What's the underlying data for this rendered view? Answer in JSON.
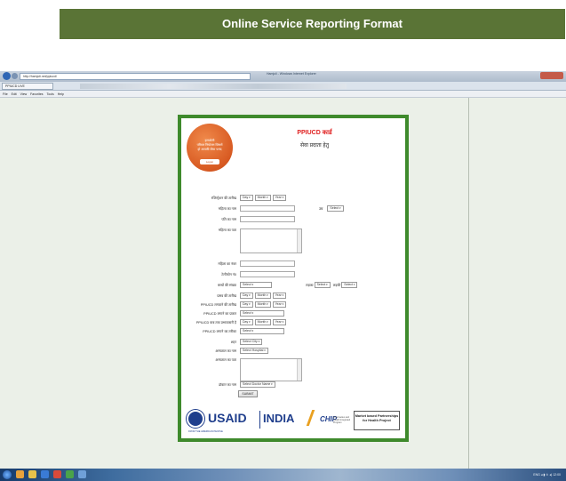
{
  "slide": {
    "title": "Online Service Reporting Format"
  },
  "browser": {
    "address": "http://hamjoli.net/ppiucd/",
    "window_title": "Hamjoli - Windows Internet Explorer",
    "tab_label": "PPIUCD LIVE",
    "menu": [
      "File",
      "Edit",
      "View",
      "Favorites",
      "Tools",
      "Help"
    ]
  },
  "form": {
    "heading": "PPIUCD कार्ड",
    "subheading": "सेवा प्रदाता हेतु",
    "badge_text": "हमजोली\nपरिवार नियोजन जिसमें\nहो आपकी जैसा पसंद",
    "badge_pill": "Logon",
    "fields": {
      "registration_date": {
        "label": "रजिस्ट्रेशन की तारीख",
        "day": "Day",
        "month": "Month",
        "year": "Year"
      },
      "woman_name": {
        "label": "महिला का नाम"
      },
      "age": {
        "label": "उम्र",
        "value": "Select"
      },
      "husband_name": {
        "label": "पति का नाम"
      },
      "woman_address": {
        "label": "महिला का पता"
      },
      "woman_mobile": {
        "label": "महिला का नंबर"
      },
      "telephone": {
        "label": "टेलीफोन नं0"
      },
      "children_count": {
        "label": "बच्चों की संख्या",
        "value": "Select",
        "boys_label": "लड़का",
        "boys_value": "Select",
        "girls_label": "लड़की",
        "girls_value": "Select"
      },
      "delivery_date": {
        "label": "प्रसव की तारीख",
        "day": "Day",
        "month": "Month",
        "year": "Year"
      },
      "ppiucd_date": {
        "label": "PPIUCD लगवाने की तारीख",
        "day": "Day",
        "month": "Month",
        "year": "Year"
      },
      "ppiucd_type": {
        "label": "PPIUCD लगाने का प्रकार",
        "value": "Select"
      },
      "ppiucd_removal_date": {
        "label": "PPIUCD कब तक प्रभावकारी है",
        "day": "Day",
        "month": "Month",
        "year": "Year"
      },
      "ppiucd_provider": {
        "label": "PPIUCD लगाने का तरीका",
        "value": "Select"
      },
      "city": {
        "label": "शहर",
        "value": "Select City"
      },
      "hospital": {
        "label": "अस्पताल का नाम",
        "value": "Select Hospital"
      },
      "hospital_address": {
        "label": "अस्पताल का पता"
      },
      "doctor_name": {
        "label": "डॉक्टर का नाम",
        "value": "Select Doctor Name"
      }
    },
    "submit_label": "SUBMIT"
  },
  "footer": {
    "usaid": "USAID",
    "usaid_tagline": "FROM THE AMERICAN PEOPLE",
    "india": "INDIA",
    "chip": "CHIP",
    "chip_sub": "Pharmacies and Health Integrated Program",
    "mbpp": "Market based Partnerships for Health Project"
  },
  "taskbar": {
    "tray_text": "ENG  ◂ ▮ ⊙ ◂)  12:00"
  },
  "colors": {
    "slide_title_bg": "#5a7436",
    "form_border": "#3e8a2c",
    "heading_red": "#e02020",
    "usaid_blue": "#1f3e8c",
    "badge_orange": "#d85a22"
  }
}
